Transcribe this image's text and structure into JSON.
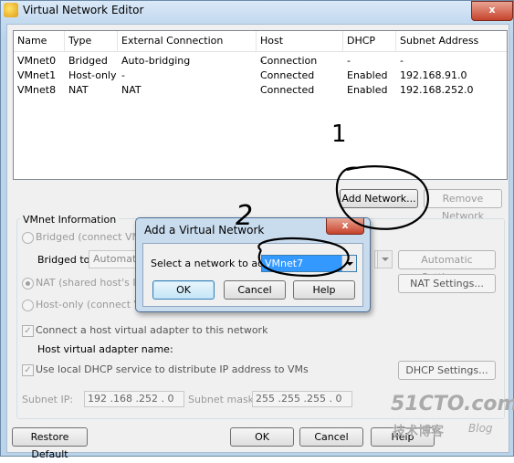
{
  "window": {
    "title": "Virtual Network Editor",
    "close_glyph": "x"
  },
  "list": {
    "columns": [
      "Name",
      "Type",
      "External Connection",
      "Host Connection",
      "DHCP",
      "Subnet Address"
    ],
    "rows": [
      [
        "VMnet0",
        "Bridged",
        "Auto-bridging",
        "-",
        "-",
        "-"
      ],
      [
        "VMnet1",
        "Host-only",
        "-",
        "Connected",
        "Enabled",
        "192.168.91.0"
      ],
      [
        "VMnet8",
        "NAT",
        "NAT",
        "Connected",
        "Enabled",
        "192.168.252.0"
      ]
    ]
  },
  "buttons": {
    "add_network": "Add Network...",
    "remove_network": "Remove Network",
    "automatic_settings": "Automatic Settings...",
    "nat_settings": "NAT Settings...",
    "dhcp_settings": "DHCP Settings...",
    "restore_default": "Restore Default",
    "ok": "OK",
    "cancel": "Cancel",
    "help": "Help"
  },
  "vmnet_info": {
    "label": "VMnet Information",
    "bridged": "Bridged (connect VMs di",
    "bridged_to_label": "Bridged to:",
    "bridged_to_value": "Automatic",
    "nat": "NAT (shared host's IP ac",
    "host_only": "Host-only (connect VMs",
    "connect_adapter": "Connect a host virtual adapter to this network",
    "adapter_name_label": "Host virtual adapter name:",
    "use_dhcp": "Use local DHCP service to distribute IP address to VMs",
    "subnet_ip_label": "Subnet IP:",
    "subnet_ip_value": "192 .168 .252 .  0",
    "subnet_mask_label": "Subnet mask:",
    "subnet_mask_value": "255 .255 .255 .  0"
  },
  "dialog": {
    "title": "Add a Virtual Network",
    "close_glyph": "x",
    "select_label": "Select a network to add:",
    "selected_network": "VMnet7",
    "ok": "OK",
    "cancel": "Cancel",
    "help": "Help"
  },
  "annotations": {
    "step1": "1",
    "step2": "2"
  },
  "watermark": {
    "site": "51CTO.com",
    "sub": "技术博客",
    "blog": "Blog"
  },
  "colors": {
    "selection": "#3399ff",
    "title_bar": "#c4daf0",
    "close_button": "#c7432c"
  }
}
